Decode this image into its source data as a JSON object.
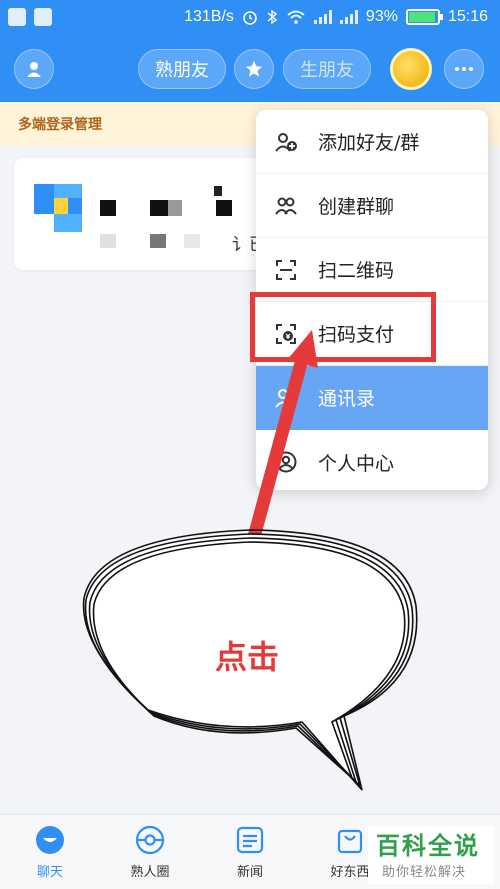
{
  "status_bar": {
    "speed": "131B/s",
    "battery": "93%",
    "battery_level": 0.93,
    "time": "15:16"
  },
  "header": {
    "tab_close_friends": "熟朋友",
    "tab_new_friends": "生朋友"
  },
  "banner": {
    "text": "多端登录管理"
  },
  "card": {
    "partial_text": "讠已"
  },
  "menu": {
    "items": [
      {
        "label": "添加好友/群",
        "icon": "add-friend-icon"
      },
      {
        "label": "创建群聊",
        "icon": "group-icon"
      },
      {
        "label": "扫二维码",
        "icon": "scan-icon"
      },
      {
        "label": "扫码支付",
        "icon": "scan-pay-icon"
      },
      {
        "label": "通讯录",
        "icon": "contacts-icon"
      },
      {
        "label": "个人中心",
        "icon": "profile-icon"
      }
    ]
  },
  "annotation": {
    "callout_text": "点击"
  },
  "tabbar": {
    "items": [
      {
        "label": "聊天",
        "icon": "chat-icon"
      },
      {
        "label": "熟人圈",
        "icon": "circle-icon"
      },
      {
        "label": "新闻",
        "icon": "news-icon"
      },
      {
        "label": "好东西",
        "icon": "bag-icon"
      }
    ]
  },
  "watermark": {
    "title": "百科全说",
    "subtitle": "助你轻松解决"
  },
  "colors": {
    "primary": "#2f8ff5",
    "highlight": "#e53a3a",
    "menu_selected": "#67a6f4",
    "banner_bg": "#fff4da"
  }
}
